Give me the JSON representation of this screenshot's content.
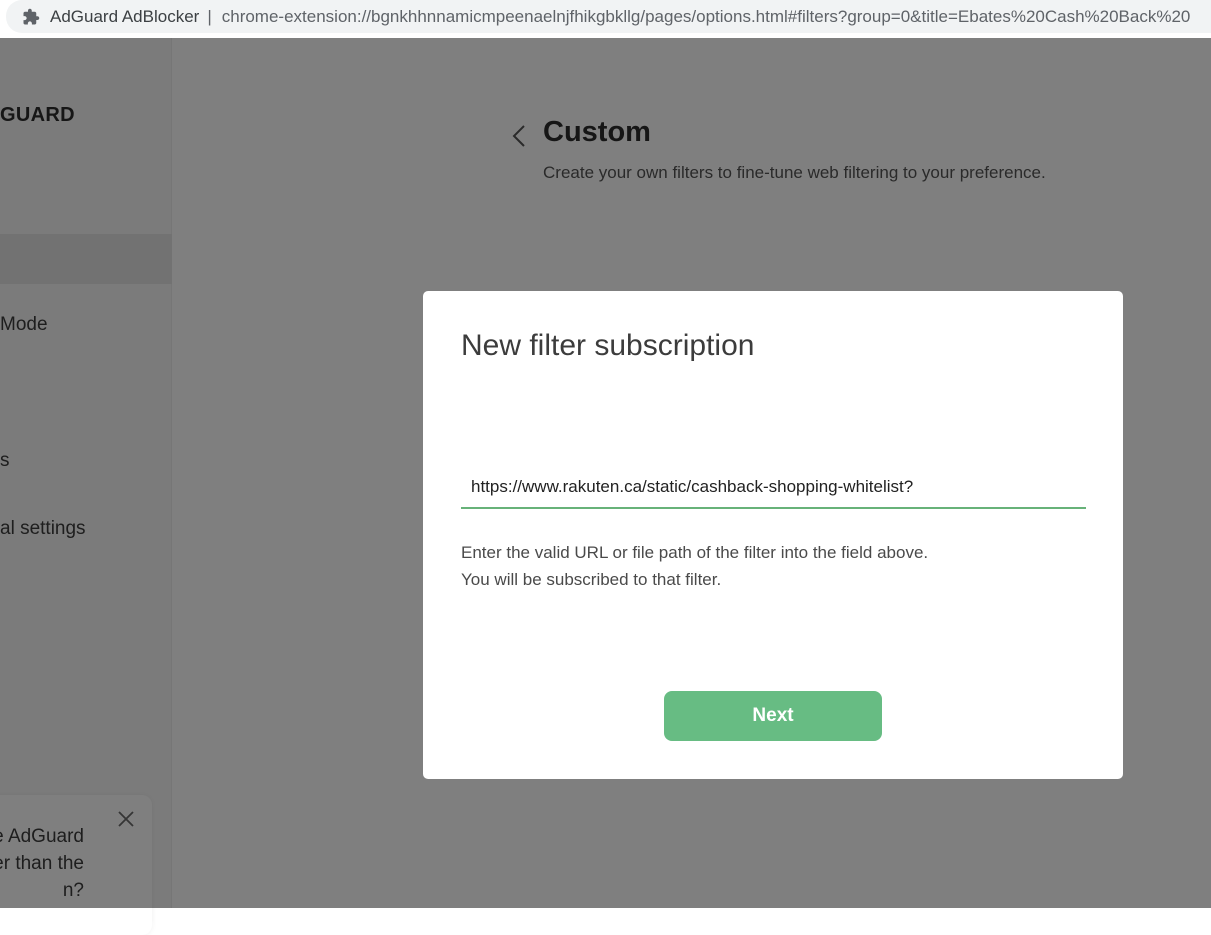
{
  "browser": {
    "site_name": "AdGuard AdBlocker",
    "separator": "|",
    "url": "chrome-extension://bgnkhhnnamicmpeenaelnjfhikgbkllg/pages/options.html#filters?group=0&title=Ebates%20Cash%20Back%20"
  },
  "sidebar": {
    "logo": "GUARD",
    "items": [
      {
        "label": "Mode"
      },
      {
        "label": "s"
      },
      {
        "label": "al settings"
      }
    ],
    "promo": {
      "line1": "he AdGuard",
      "line2": "er than the",
      "line3": "n?"
    }
  },
  "page": {
    "title": "Custom",
    "subtitle": "Create your own filters to fine-tune web filtering to your preference."
  },
  "modal": {
    "title": "New filter subscription",
    "input_value": "https://www.rakuten.ca/static/cashback-shopping-whitelist?",
    "hint_line1": "Enter the valid URL or file path of the filter into the field above.",
    "hint_line2": "You will be subscribed to that filter.",
    "next_label": "Next"
  },
  "colors": {
    "accent": "#67bc83",
    "input_underline": "#67b279",
    "overlay": "rgba(0,0,0,0.5)"
  }
}
